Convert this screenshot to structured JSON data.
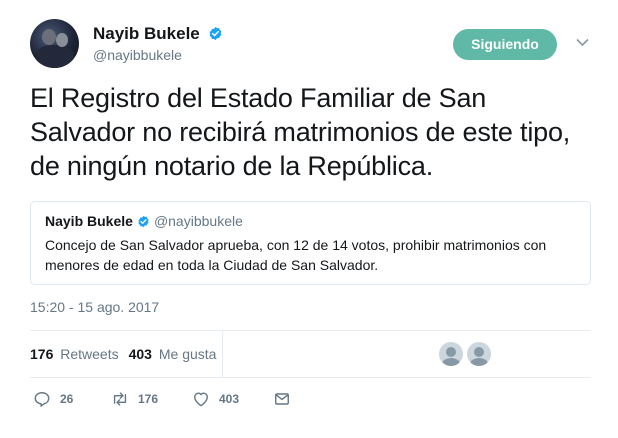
{
  "author": {
    "name": "Nayib Bukele",
    "handle": "@nayibbukele",
    "verified_icon": "verified-badge-icon"
  },
  "follow_button": {
    "label": "Siguiendo"
  },
  "tweet": {
    "text": "El Registro del Estado Familiar de San Salvador no recibirá matrimonios de este tipo, de ningún notario de la República.",
    "timestamp": "15:20 - 15 ago. 2017"
  },
  "quoted_tweet": {
    "name": "Nayib Bukele",
    "handle": "@nayibbukele",
    "text": "Concejo de San Salvador aprueba, con 12 de 14 votos, prohibir matrimonios con menores de edad en toda la Ciudad de San Salvador."
  },
  "stats": {
    "retweets_count": "176",
    "retweets_label": "Retweets",
    "likes_count": "403",
    "likes_label": "Me gusta"
  },
  "actions": {
    "reply_count": "26",
    "retweet_count": "176",
    "like_count": "403"
  },
  "colors": {
    "follow_button": "#5fb9a6",
    "verified": "#1da1f2",
    "secondary_text": "#657786"
  }
}
